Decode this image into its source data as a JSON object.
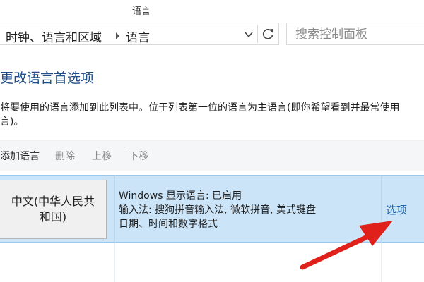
{
  "window": {
    "title": "语言"
  },
  "address": {
    "breadcrumb": [
      "时钟、语言和区域",
      "语言"
    ]
  },
  "search": {
    "placeholder": "搜索控制面板"
  },
  "main": {
    "title": "更改语言首选项",
    "description_lines": [
      "将要使用的语言添加到此列表中。位于列表第一位的语言为主语言(即你希望看到并最常使用",
      "言)。"
    ]
  },
  "toolbar": {
    "add": "添加语言",
    "remove": "删除",
    "move_up": "上移",
    "move_down": "下移"
  },
  "languages": [
    {
      "name": "中文(中华人民共和国)",
      "name_lines": [
        "中文(中华人民共",
        "和国)"
      ],
      "display_status": "Windows 显示语言: 已启用",
      "input_methods": "输入法: 搜狗拼音输入法, 微软拼音, 美式键盘",
      "formats": "日期、时间和数字格式",
      "options_label": "选项"
    }
  ],
  "colors": {
    "selected_row": "#cce4f7",
    "link": "#1a63b5",
    "title": "#1f4f8b",
    "arrow": "#e0201b"
  },
  "icons": {
    "dropdown": "chevron-down-icon",
    "refresh": "refresh-icon",
    "breadcrumb_separator": "triangle-right-icon",
    "annotation": "red-arrow-icon"
  }
}
